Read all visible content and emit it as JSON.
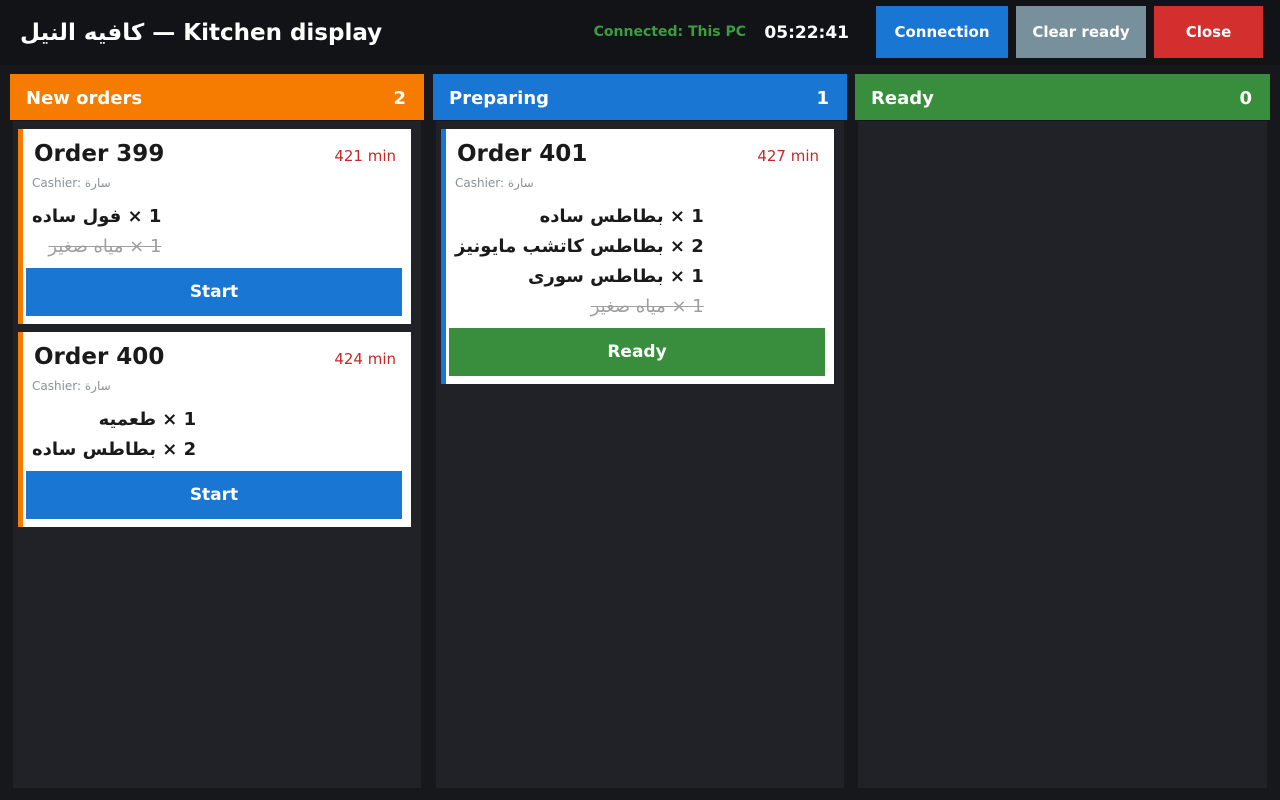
{
  "header": {
    "title": "كافيه النيل — Kitchen display",
    "connection_status": "Connected: This PC",
    "clock": "05:22:41",
    "buttons": {
      "connection": "Connection",
      "clear_ready": "Clear ready",
      "close": "Close"
    }
  },
  "colors": {
    "new": "#f57c00",
    "preparing": "#1976d2",
    "ready": "#388e3c",
    "clear": "#78909c",
    "close": "#d32f2f"
  },
  "columns": [
    {
      "title": "New orders",
      "count": "2",
      "orders": [
        {
          "title": "Order 399",
          "elapsed": "421 min",
          "cashier": "Cashier: سارة",
          "items": [
            {
              "text": "1 × فول ساده",
              "done": false
            },
            {
              "text": "1 × مياه صغير",
              "done": true
            }
          ],
          "action": "Start"
        },
        {
          "title": "Order 400",
          "elapsed": "424 min",
          "cashier": "Cashier: سارة",
          "items": [
            {
              "text": "1 × طعميه",
              "done": false
            },
            {
              "text": "2 × بطاطس ساده",
              "done": false
            }
          ],
          "action": "Start"
        }
      ]
    },
    {
      "title": "Preparing",
      "count": "1",
      "orders": [
        {
          "title": "Order 401",
          "elapsed": "427 min",
          "cashier": "Cashier: سارة",
          "items": [
            {
              "text": "1 × بطاطس ساده",
              "done": false
            },
            {
              "text": "2 × بطاطس كاتشب مايونيز",
              "done": false
            },
            {
              "text": "1 × بطاطس سورى",
              "done": false
            },
            {
              "text": "1 × مياه صغير",
              "done": true
            }
          ],
          "action": "Ready"
        }
      ]
    },
    {
      "title": "Ready",
      "count": "0",
      "orders": []
    }
  ]
}
